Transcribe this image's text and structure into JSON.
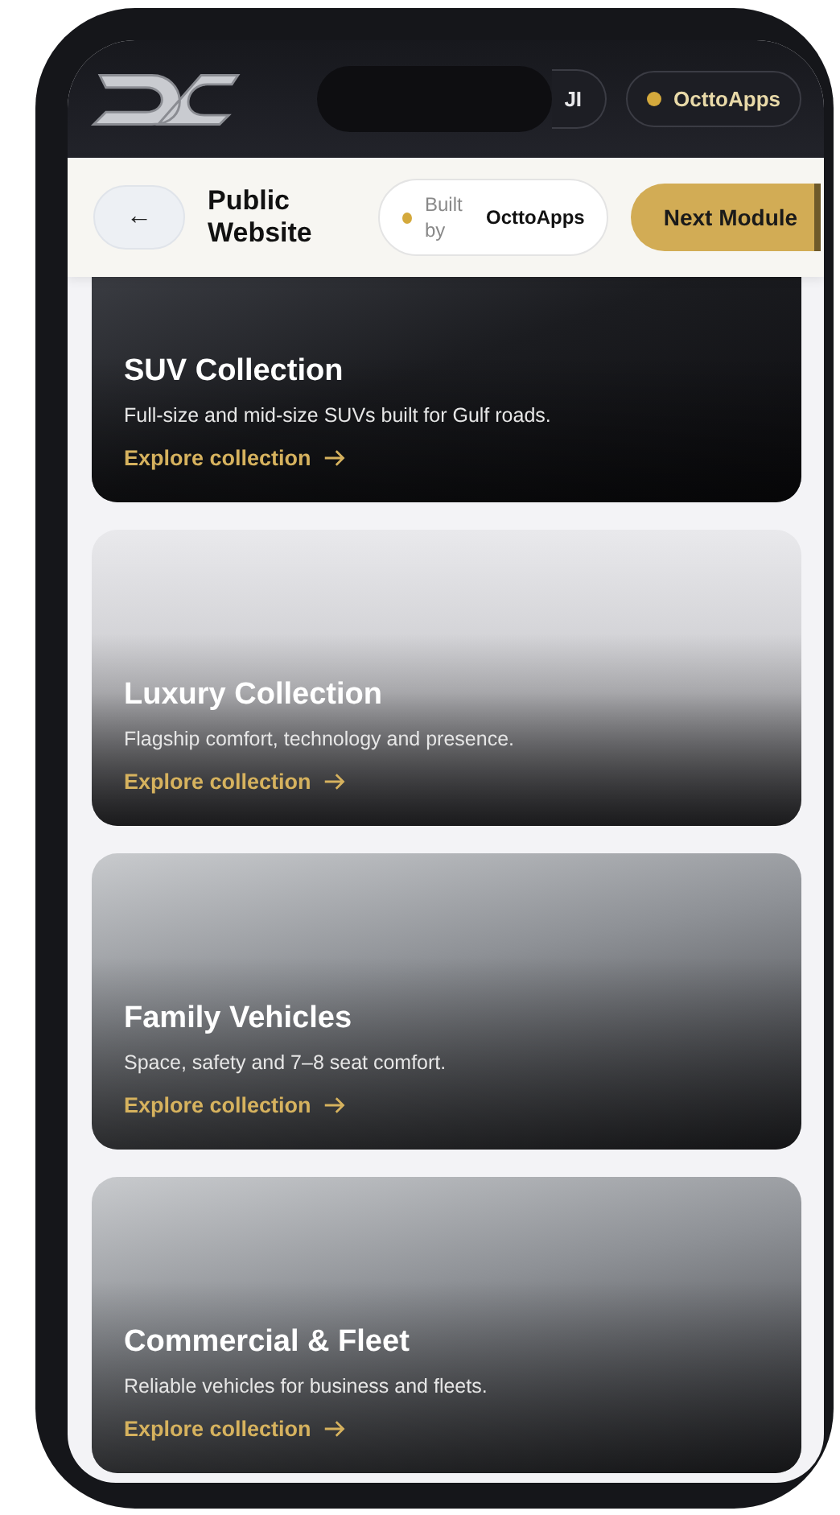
{
  "header": {
    "language_pill": "JI",
    "brand_badge": {
      "label": "OcttoApps"
    }
  },
  "toolbar": {
    "back": "←",
    "title": "Public Website",
    "built_by": {
      "prefix": "Built by",
      "name": "OcttoApps"
    },
    "next_button": "Next Module"
  },
  "collections": [
    {
      "title": "SUV Collection",
      "description": "Full-size and mid-size SUVs built for Gulf roads.",
      "link": "Explore collection"
    },
    {
      "title": "Luxury Collection",
      "description": "Flagship comfort, technology and presence.",
      "link": "Explore collection"
    },
    {
      "title": "Family Vehicles",
      "description": "Space, safety and 7–8 seat comfort.",
      "link": "Explore collection"
    },
    {
      "title": "Commercial & Fleet",
      "description": "Reliable vehicles for business and fleets.",
      "link": "Explore collection"
    }
  ]
}
